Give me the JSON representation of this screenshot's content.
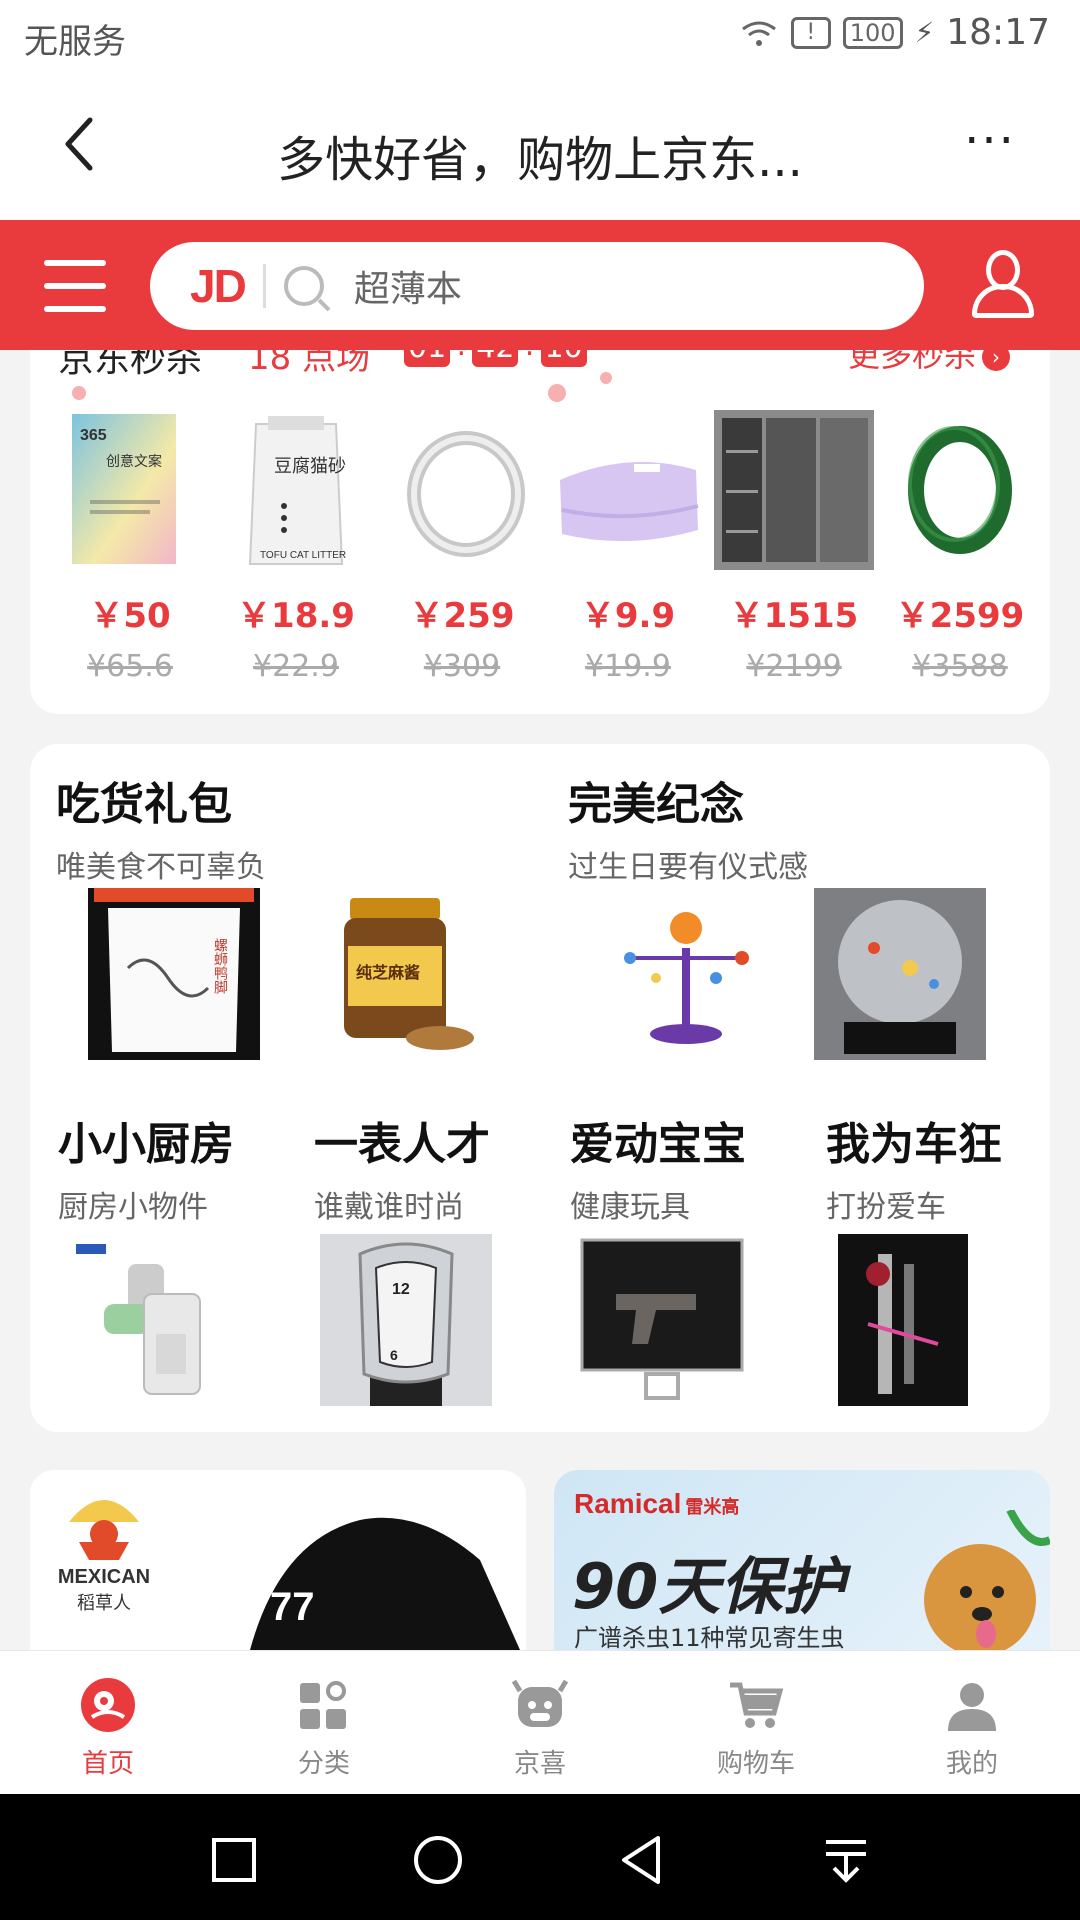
{
  "status_bar": {
    "carrier": "无服务",
    "battery": "100",
    "time": "18:17"
  },
  "title_bar": {
    "title": "多快好省，购物上京东...",
    "more": "···"
  },
  "search": {
    "logo": "JD",
    "placeholder": "超薄本"
  },
  "seckill": {
    "title": "京东秒杀",
    "round": "18 点场",
    "countdown": [
      "01",
      "42",
      "10"
    ],
    "more": "更多秒杀",
    "items": [
      {
        "name": "创意文案书",
        "price": "￥50",
        "original": "¥65.6"
      },
      {
        "name": "豆腐猫砂",
        "price": "￥18.9",
        "original": "¥22.9"
      },
      {
        "name": "银手镯",
        "price": "￥259",
        "original": "¥309"
      },
      {
        "name": "毛毯",
        "price": "￥9.9",
        "original": "¥19.9"
      },
      {
        "name": "衣柜",
        "price": "￥1515",
        "original": "¥2199"
      },
      {
        "name": "翡翠手镯",
        "price": "￥2599",
        "original": "¥3588"
      }
    ]
  },
  "gift": {
    "top": [
      {
        "title": "吃货礼包",
        "subtitle": "唯美食不可辜负"
      },
      {
        "title": "完美纪念",
        "subtitle": "过生日要有仪式感"
      }
    ],
    "bottom": [
      {
        "title": "小小厨房",
        "subtitle": "厨房小物件"
      },
      {
        "title": "一表人才",
        "subtitle": "谁戴谁时尚"
      },
      {
        "title": "爱动宝宝",
        "subtitle": "健康玩具"
      },
      {
        "title": "我为车狂",
        "subtitle": "打扮爱车"
      }
    ]
  },
  "banners": {
    "left": {
      "brand": "MEXICAN",
      "brand_cn": "稻草人"
    },
    "right": {
      "brand": "Ramical",
      "brand_cn": "雷米高",
      "headline": "90天保护",
      "sub": "广谱杀虫11种常见寄生虫"
    }
  },
  "tabs": [
    {
      "label": "首页",
      "icon": "home-icon",
      "active": true
    },
    {
      "label": "分类",
      "icon": "category-icon",
      "active": false
    },
    {
      "label": "京喜",
      "icon": "jingxi-icon",
      "active": false
    },
    {
      "label": "购物车",
      "icon": "cart-icon",
      "active": false
    },
    {
      "label": "我的",
      "icon": "profile-icon",
      "active": false
    }
  ],
  "colors": {
    "brand_red": "#e93b3d",
    "price_red": "#e93b3d"
  }
}
